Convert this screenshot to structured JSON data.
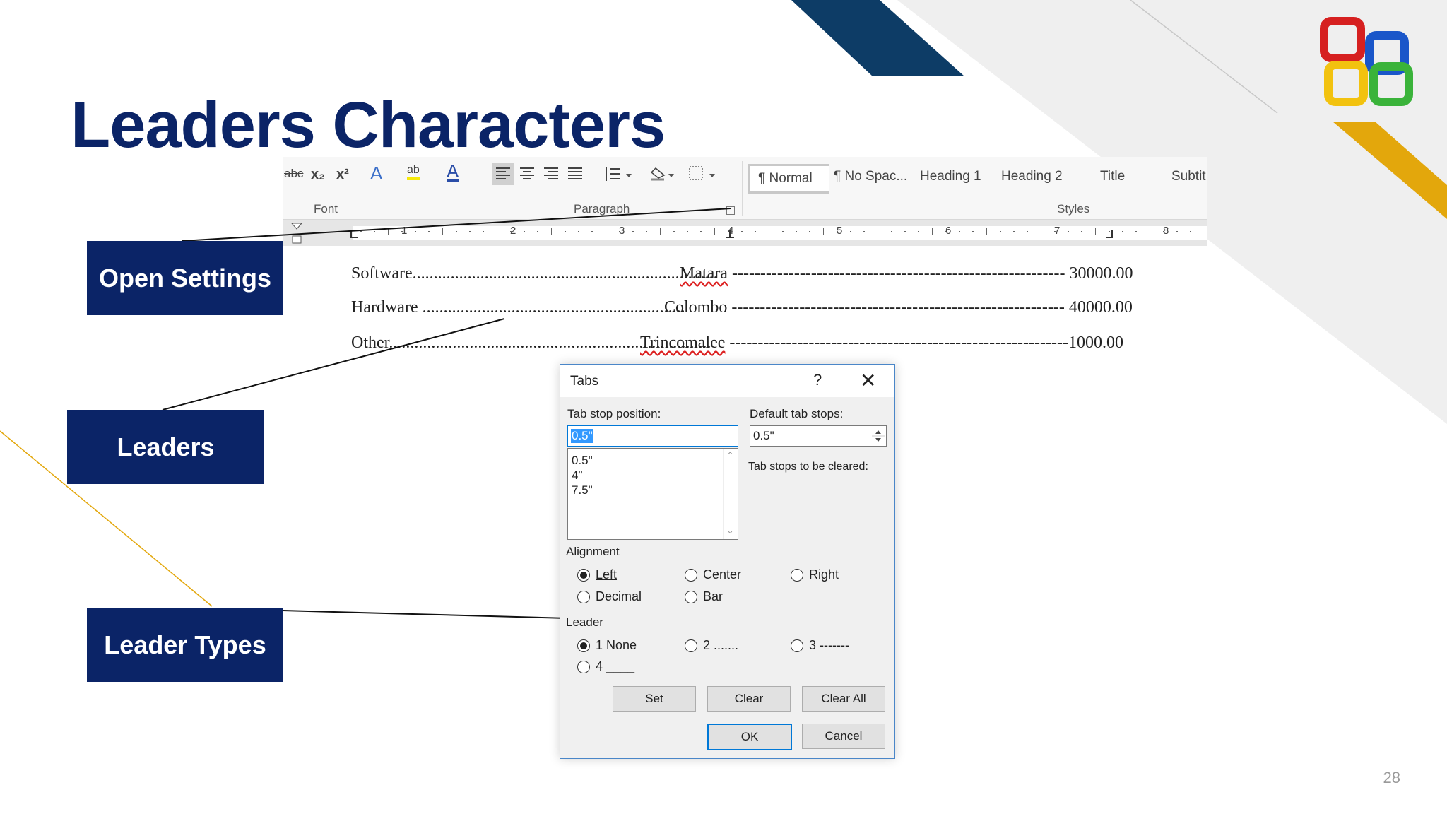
{
  "slide": {
    "title": "Leaders Characters",
    "page_number": "28",
    "callouts": {
      "open_settings": "Open Settings",
      "leaders": "Leaders",
      "leader_types": "Leader Types"
    }
  },
  "ribbon": {
    "font_group_label": "Font",
    "paragraph_group_label": "Paragraph",
    "styles_group_label": "Styles",
    "font_icons": [
      "abc",
      "x₂",
      "x²",
      "A",
      "ab",
      "A"
    ],
    "styles": [
      "¶ Normal",
      "¶ No Spac...",
      "Heading 1",
      "Heading 2",
      "Title",
      "Subtit"
    ]
  },
  "ruler": {
    "numbers": [
      "1",
      "2",
      "3",
      "4",
      "5",
      "6",
      "7",
      "8"
    ]
  },
  "document": {
    "rows": [
      {
        "col1": "Software",
        "col2": "Matara",
        "col3": "30000.00"
      },
      {
        "col1": "Hardware",
        "col2": "Colombo",
        "col3": "40000.00"
      },
      {
        "col1": "Other",
        "col2": "Trincomalee",
        "col3": "1000.00"
      }
    ]
  },
  "dialog": {
    "title": "Tabs",
    "help": "?",
    "close": "✕",
    "tab_stop_label": "Tab stop position:",
    "tab_stop_value": "0.5\"",
    "tab_stop_list": [
      "0.5\"",
      "4\"",
      "7.5\""
    ],
    "default_tab_label": "Default tab stops:",
    "default_tab_value": "0.5\"",
    "cleared_label": "Tab stops to be cleared:",
    "alignment_label": "Alignment",
    "alignment_options": [
      "Left",
      "Center",
      "Right",
      "Decimal",
      "Bar"
    ],
    "alignment_selected": "Left",
    "leader_label": "Leader",
    "leader_options": [
      "1 None",
      "2 .......",
      "3 -------",
      "4 ____"
    ],
    "leader_selected": "1 None",
    "buttons": {
      "set": "Set",
      "clear": "Clear",
      "clear_all": "Clear All",
      "ok": "OK",
      "cancel": "Cancel"
    }
  },
  "colors": {
    "navy": "#0b2467",
    "dark_blue_band": "#0d3c66",
    "gold": "#e3a70c",
    "light_gray": "#eeeeee",
    "dialog_border": "#4a86c8"
  }
}
